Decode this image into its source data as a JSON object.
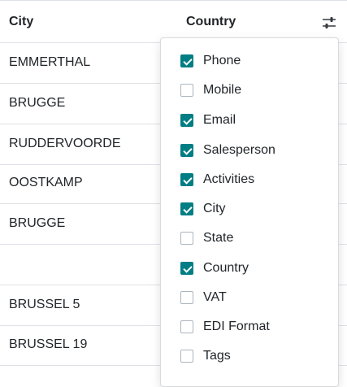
{
  "columns": {
    "city": "City",
    "country": "Country"
  },
  "icons": {
    "settings": "optional-columns-toggle-icon"
  },
  "rows": [
    {
      "city": "EMMERTHAL"
    },
    {
      "city": "BRUGGE"
    },
    {
      "city": "RUDDERVOORDE"
    },
    {
      "city": "OOSTKAMP"
    },
    {
      "city": "BRUGGE"
    },
    {
      "city": ""
    },
    {
      "city": "BRUSSEL 5"
    },
    {
      "city": "BRUSSEL 19"
    }
  ],
  "optional_columns": [
    {
      "label": "Phone",
      "checked": true
    },
    {
      "label": "Mobile",
      "checked": false
    },
    {
      "label": "Email",
      "checked": true
    },
    {
      "label": "Salesperson",
      "checked": true
    },
    {
      "label": "Activities",
      "checked": true
    },
    {
      "label": "City",
      "checked": true
    },
    {
      "label": "State",
      "checked": false
    },
    {
      "label": "Country",
      "checked": true
    },
    {
      "label": "VAT",
      "checked": false
    },
    {
      "label": "EDI Format",
      "checked": false
    },
    {
      "label": "Tags",
      "checked": false
    }
  ],
  "colors": {
    "accent": "#017e84",
    "border": "#dee2e6",
    "text": "#212529"
  }
}
